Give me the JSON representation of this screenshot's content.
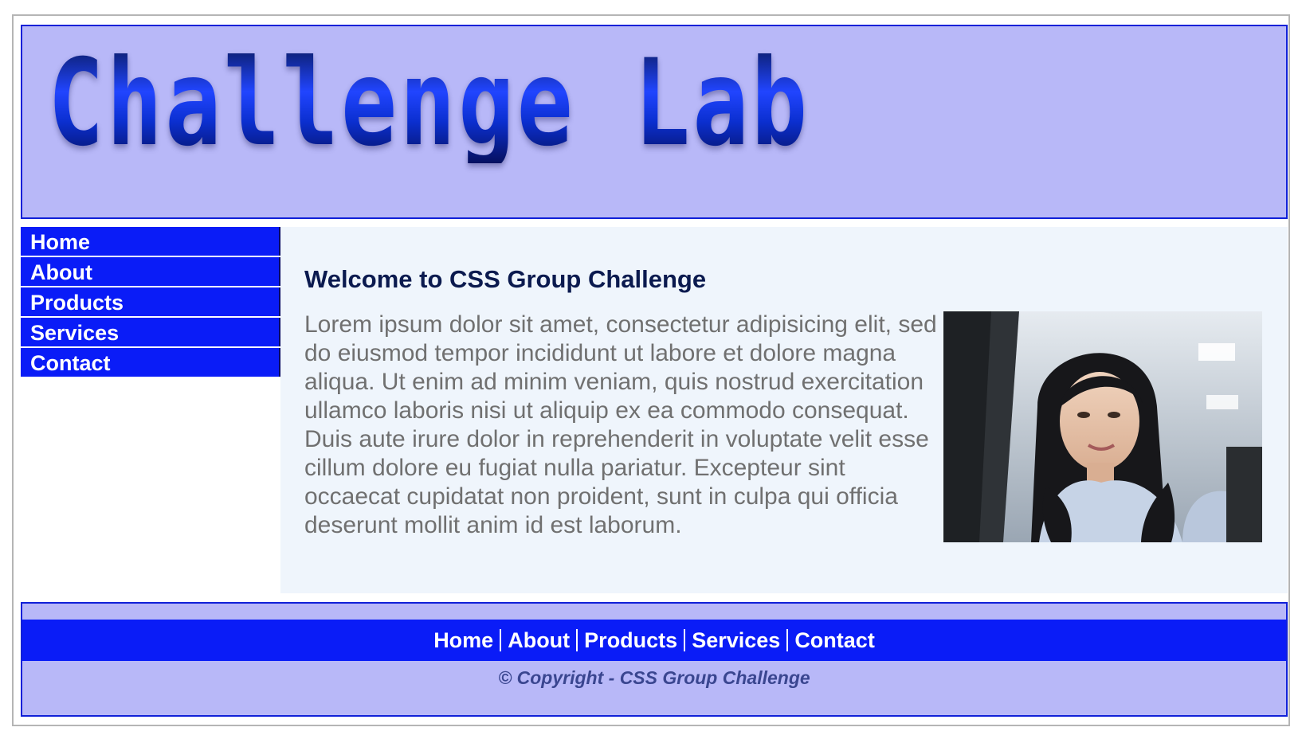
{
  "header": {
    "logo_text": "Challenge Lab"
  },
  "sidebar": {
    "items": [
      {
        "label": "Home"
      },
      {
        "label": "About"
      },
      {
        "label": "Products"
      },
      {
        "label": "Services"
      },
      {
        "label": "Contact"
      }
    ]
  },
  "main": {
    "title": "Welcome to CSS Group Challenge",
    "body": "Lorem ipsum dolor sit amet, consectetur adipisicing elit, sed do eiusmod tempor incididunt ut labore et dolore magna aliqua. Ut enim ad minim veniam, quis nostrud exercitation ullamco laboris nisi ut aliquip ex ea commodo consequat. Duis aute irure dolor in reprehenderit in voluptate velit esse cillum dolore eu fugiat nulla pariatur. Excepteur sint occaecat cupidatat non proident, sunt in culpa qui officia deserunt mollit anim id est laborum."
  },
  "footer": {
    "links": [
      {
        "label": "Home"
      },
      {
        "label": "About"
      },
      {
        "label": "Products"
      },
      {
        "label": "Services"
      },
      {
        "label": "Contact"
      }
    ],
    "copyright": "© Copyright - CSS Group Challenge"
  },
  "colors": {
    "accent": "#0a1cf7",
    "header_bg": "#b8b8f8",
    "content_bg": "#eff5fc"
  }
}
